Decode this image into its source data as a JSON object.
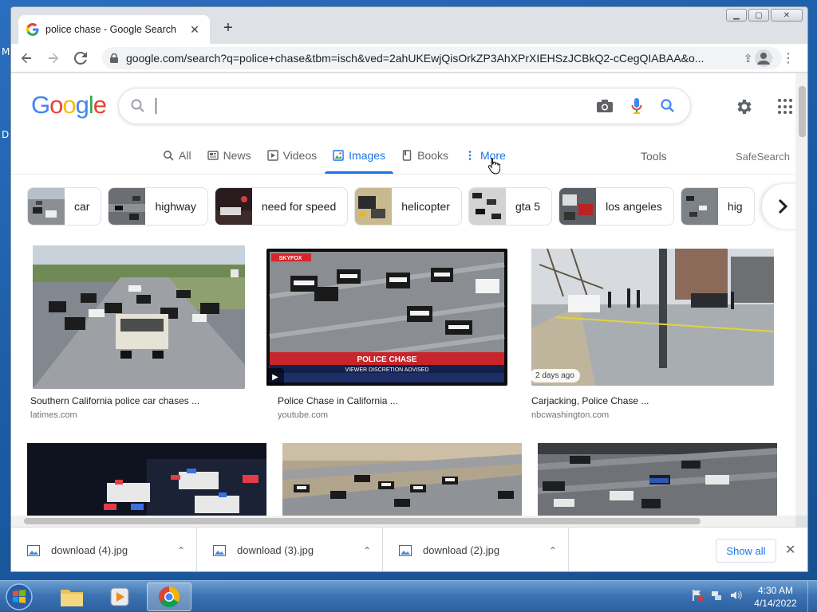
{
  "tab": {
    "title": "police chase - Google Search"
  },
  "address_bar": {
    "url": "google.com/search?q=police+chase&tbm=isch&ved=2ahUKEwjQisOrkZP3AhXPrXIEHSzJCBkQ2-cCegQIABAA&o..."
  },
  "google": {
    "logo_letters": [
      "G",
      "o",
      "o",
      "g",
      "l",
      "e"
    ],
    "logo_colors": [
      "#4285f4",
      "#ea4335",
      "#fbbc05",
      "#4285f4",
      "#34a853",
      "#ea4335"
    ],
    "search_value": ""
  },
  "nav_tabs": [
    {
      "label": "All",
      "icon": "search-icon"
    },
    {
      "label": "News",
      "icon": "news-icon"
    },
    {
      "label": "Videos",
      "icon": "video-icon"
    },
    {
      "label": "Images",
      "icon": "image-icon",
      "active": true
    },
    {
      "label": "Books",
      "icon": "book-icon"
    },
    {
      "label": "More",
      "icon": "more-vertical-icon"
    }
  ],
  "tools_label": "Tools",
  "safesearch_label": "SafeSearch",
  "chips": [
    {
      "label": "car"
    },
    {
      "label": "highway"
    },
    {
      "label": "need for speed"
    },
    {
      "label": "helicopter"
    },
    {
      "label": "gta 5"
    },
    {
      "label": "los angeles"
    },
    {
      "label": "hig"
    }
  ],
  "results": [
    {
      "title": "Southern California police car chases ...",
      "source": "latimes.com"
    },
    {
      "title": "Police Chase in California ...",
      "source": "youtube.com",
      "overlay_title": "POLICE CHASE",
      "overlay_sub": "VIEWER DISCRETION ADVISED",
      "overlay_logo": "SKYFOX"
    },
    {
      "title": "Carjacking, Police Chase ...",
      "source": "nbcwashington.com",
      "badge": "2 days ago"
    }
  ],
  "downloads": [
    {
      "name": "download (4).jpg"
    },
    {
      "name": "download (3).jpg"
    },
    {
      "name": "download (2).jpg"
    }
  ],
  "show_all_label": "Show all",
  "clock": {
    "time": "4:30 AM",
    "date": "4/14/2022"
  },
  "colors": {
    "accent": "#1a73e8",
    "taskbar": "#3e74b3"
  }
}
